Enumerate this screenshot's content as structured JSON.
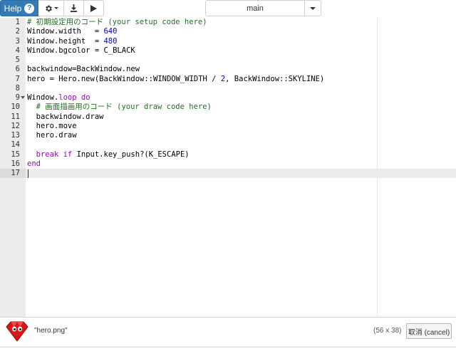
{
  "toolbar": {
    "help_label": "Help",
    "help_icon": "?",
    "gear_icon": "gear-icon",
    "download_icon": "download-icon",
    "run_icon": "play-icon",
    "branch_selected": "main"
  },
  "editor": {
    "lines": [
      {
        "n": "1",
        "tokens": [
          {
            "t": "# 初期設定用のコード (your setup code here)",
            "c": "comment"
          }
        ]
      },
      {
        "n": "2",
        "tokens": [
          {
            "t": "Window.width   = "
          },
          {
            "t": "640",
            "c": "num"
          }
        ]
      },
      {
        "n": "3",
        "tokens": [
          {
            "t": "Window.height  = "
          },
          {
            "t": "480",
            "c": "num"
          }
        ]
      },
      {
        "n": "4",
        "tokens": [
          {
            "t": "Window.bgcolor = C_BLACK"
          }
        ]
      },
      {
        "n": "5",
        "tokens": []
      },
      {
        "n": "6",
        "tokens": [
          {
            "t": "backwindow=BackWindow.new"
          }
        ]
      },
      {
        "n": "7",
        "tokens": [
          {
            "t": "hero = Hero.new(BackWindow::WINDOW_WIDTH / "
          },
          {
            "t": "2",
            "c": "num"
          },
          {
            "t": ", BackWindow::SKYLINE)"
          }
        ]
      },
      {
        "n": "8",
        "tokens": []
      },
      {
        "n": "9",
        "fold": true,
        "tokens": [
          {
            "t": "Window."
          },
          {
            "t": "loop",
            "c": "kw"
          },
          {
            "t": " "
          },
          {
            "t": "do",
            "c": "kw"
          }
        ]
      },
      {
        "n": "10",
        "tokens": [
          {
            "t": "  "
          },
          {
            "t": "# 画面描画用のコード (your draw code here)",
            "c": "comment"
          }
        ]
      },
      {
        "n": "11",
        "tokens": [
          {
            "t": "  backwindow.draw"
          }
        ]
      },
      {
        "n": "12",
        "tokens": [
          {
            "t": "  hero.move"
          }
        ]
      },
      {
        "n": "13",
        "tokens": [
          {
            "t": "  hero.draw"
          }
        ]
      },
      {
        "n": "14",
        "tokens": []
      },
      {
        "n": "15",
        "tokens": [
          {
            "t": "  "
          },
          {
            "t": "break",
            "c": "kw"
          },
          {
            "t": " "
          },
          {
            "t": "if",
            "c": "kw"
          },
          {
            "t": " Input.key_push?(K_ESCAPE)"
          }
        ]
      },
      {
        "n": "16",
        "tokens": [
          {
            "t": "end",
            "c": "kw"
          }
        ]
      },
      {
        "n": "17",
        "tokens": [],
        "cursor": true
      }
    ]
  },
  "asset": {
    "thumb_icon": "hero-sprite-icon",
    "name": "\"hero.png\"",
    "size": "(56 x 38)",
    "cancel_label": "取消 (cancel)"
  },
  "colors": {
    "help_button": "#337ab7",
    "comment": "#236e24",
    "number": "#0000cd",
    "keyword": "#9a00c7",
    "hero_red": "#d81818"
  }
}
